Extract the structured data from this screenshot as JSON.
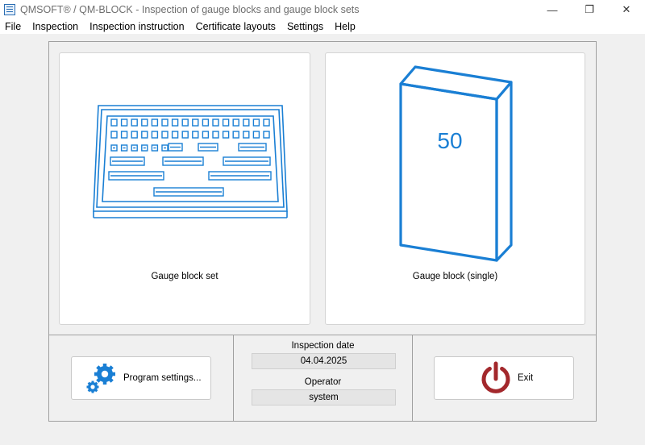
{
  "window": {
    "title": "QMSOFT® / QM-BLOCK - Inspection of gauge blocks and gauge block sets",
    "controls": {
      "minimize": "—",
      "maximize": "❐",
      "close": "✕"
    }
  },
  "menu": [
    "File",
    "Inspection",
    "Inspection instruction",
    "Certificate layouts",
    "Settings",
    "Help"
  ],
  "tiles": {
    "set_label": "Gauge block set",
    "single_label": "Gauge block (single)",
    "single_number": "50"
  },
  "buttons": {
    "settings_label": "Program settings...",
    "exit_label": "Exit"
  },
  "info": {
    "date_label": "Inspection date",
    "date_value": "04.04.2025",
    "operator_label": "Operator",
    "operator_value": "system"
  },
  "colors": {
    "accent_blue": "#1a7fd4",
    "power_red": "#a3282c"
  }
}
